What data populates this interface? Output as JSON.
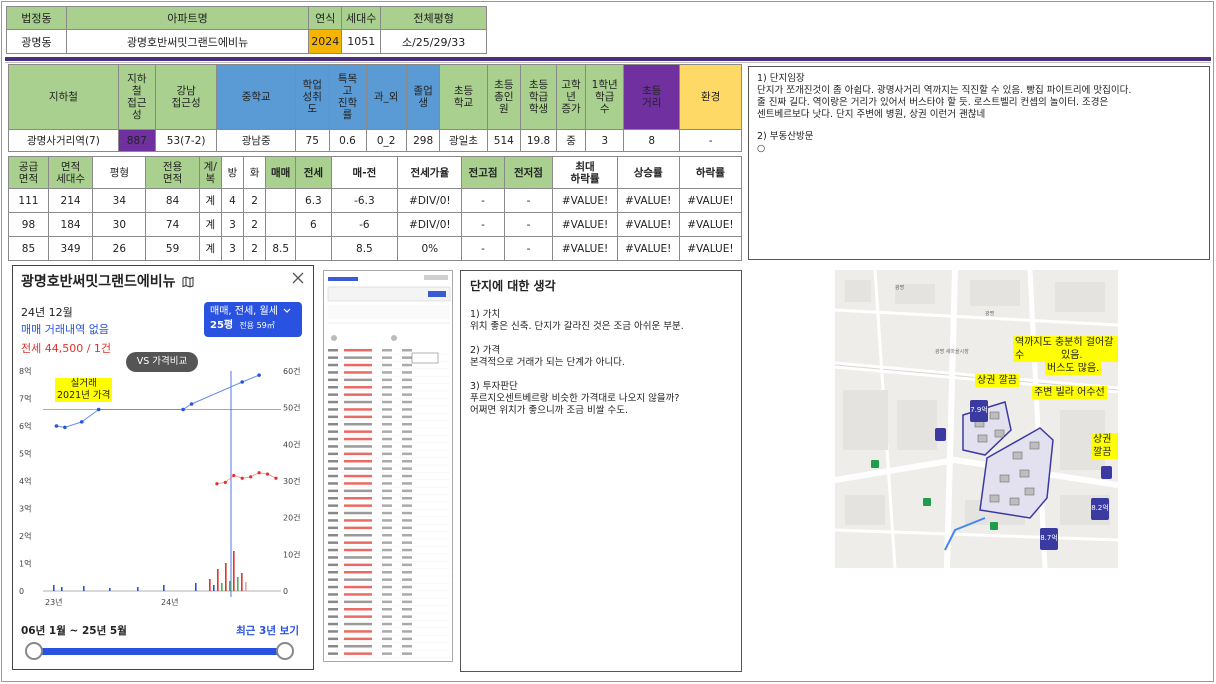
{
  "header": {
    "cols": [
      "법정동",
      "아파트명",
      "연식",
      "세대수",
      "전체평형"
    ],
    "values": [
      "광명동",
      "광명호반써밋그랜드에비뉴",
      "2024",
      "1051",
      "소/25/29/33"
    ]
  },
  "summary": {
    "headers": [
      "지하철",
      "지하철접근성",
      "강남접근성",
      "중학교",
      "학업성취도",
      "특목고진학률",
      "과_외",
      "졸업생",
      "초등학교",
      "초등총인원",
      "초등학급학생",
      "고학년증가",
      "1학년학급수",
      "초등거리",
      "환경"
    ],
    "headers_display": [
      "지하철",
      "지하\n철\n접근\n성",
      "강남\n접근성",
      "중학교",
      "학업\n성취\n도",
      "특목\n고\n진학\n률",
      "과_외",
      "졸업\n생",
      "초등\n학교",
      "초등\n총인\n원",
      "초등\n학급\n학생",
      "고학\n년\n증가",
      "1학년\n학급\n수",
      "초등\n거리",
      "환경"
    ],
    "values": [
      "광명사거리역(7)",
      "887",
      "53(7-2)",
      "광남중",
      "75",
      "0.6",
      "0_2",
      "298",
      "광일초",
      "514",
      "19.8",
      "중",
      "3",
      "8",
      "-"
    ]
  },
  "units": {
    "headers": [
      "공급면적",
      "면적세대수",
      "평형",
      "전용면적",
      "계/복",
      "방",
      "화",
      "매매",
      "전세",
      "매-전",
      "전세가율",
      "전고점",
      "전저점",
      "최대하락률",
      "상승률",
      "하락률"
    ],
    "headers_display": [
      "공급\n면적",
      "면적\n세대수",
      "평형",
      "전용\n면적",
      "계/\n복",
      "방",
      "화",
      "매매",
      "전세",
      "매-전",
      "전세가율",
      "전고점",
      "전저점",
      "최대\n하락률",
      "상승률",
      "하락률"
    ],
    "rows": [
      [
        "111",
        "214",
        "34",
        "84",
        "계",
        "4",
        "2",
        "",
        "6.3",
        "-6.3",
        "#DIV/0!",
        "-",
        "-",
        "#VALUE!",
        "#VALUE!",
        "#VALUE!"
      ],
      [
        "98",
        "184",
        "30",
        "74",
        "계",
        "3",
        "2",
        "",
        "6",
        "-6",
        "#DIV/0!",
        "-",
        "-",
        "#VALUE!",
        "#VALUE!",
        "#VALUE!"
      ],
      [
        "85",
        "349",
        "26",
        "59",
        "계",
        "3",
        "2",
        "8.5",
        "",
        "8.5",
        "0%",
        "-",
        "-",
        "#VALUE!",
        "#VALUE!",
        "#VALUE!"
      ]
    ]
  },
  "notes": {
    "h1": "1) 단지임장",
    "p1": "단지가 쪼개진것이 좀 아쉽다. 광명사거리 역까지는 직진할 수 있음. 빵집 파이트리에 맛집이다.",
    "p2": "줄 진짜 길다. 역이랑은 거리가 있어서 버스타야 할 듯. 로스트벨리 컨셉의 놀이터. 조경은",
    "p3": "센트베르보다 낫다. 단지 주변에 병원, 상권 이런거 괜찮네",
    "h2": "2) 부동산방문",
    "bullet": "○"
  },
  "chart": {
    "title": "광명호반써밋그랜드에비뉴",
    "map_icon": "map-icon",
    "date": "24년 12월",
    "trade_text": "매매 거래내역 없음",
    "jeonse_text": "전세 44,500 / 1건",
    "filter_label": "매매, 전세, 월세",
    "size_label": "25평",
    "size_sub": "전용 59㎡",
    "compare_label": "VS 가격비교",
    "annotation": "실거래\n2021년 가격",
    "left_ticks": [
      "8억",
      "7억",
      "6억",
      "5억",
      "4억",
      "3억",
      "2억",
      "1억",
      "0"
    ],
    "right_ticks": [
      "60건",
      "50건",
      "40건",
      "30건",
      "20건",
      "10건",
      "0"
    ],
    "x_ticks": [
      "23년",
      "24년"
    ],
    "range_label": "06년 1월 ~ 25년 5월",
    "recent_label": "최근 3년 보기",
    "accent": "#2952e0",
    "red": "#e0332b"
  },
  "chart_data": {
    "type": "line",
    "x": [
      "2022-11",
      "2022-12",
      "2023-02",
      "2023-04",
      "2024-02",
      "2024-03",
      "2024-09",
      "2024-11"
    ],
    "series": [
      {
        "values": [
          6.0,
          5.95,
          6.15,
          6.6,
          6.6,
          6.8,
          7.6,
          7.85
        ]
      }
    ],
    "ylim": [
      0,
      8
    ]
  },
  "think": {
    "title": "단지에 대한 생각",
    "h1": "1) 가치",
    "p1": "위치 좋은 신축. 단지가 갈라진 것은 조금 아쉬운 부분.",
    "h2": "2) 가격",
    "p2": "본격적으로 거래가 되는 단계가 아니다.",
    "h3": "3) 투자판단",
    "p3a": "푸르지오센트베르랑 비슷한 가격대로 나오지 않을까?",
    "p3b": "어쩌면 위치가 좋으니까 조금 비쌀 수도."
  },
  "map": {
    "labels": [
      "역까지도 충분히 걸어갈 수",
      "있음.",
      "버스도 많음.",
      "상권 깔끔",
      "주변 빌라 어수선",
      "상권깔끔"
    ]
  }
}
